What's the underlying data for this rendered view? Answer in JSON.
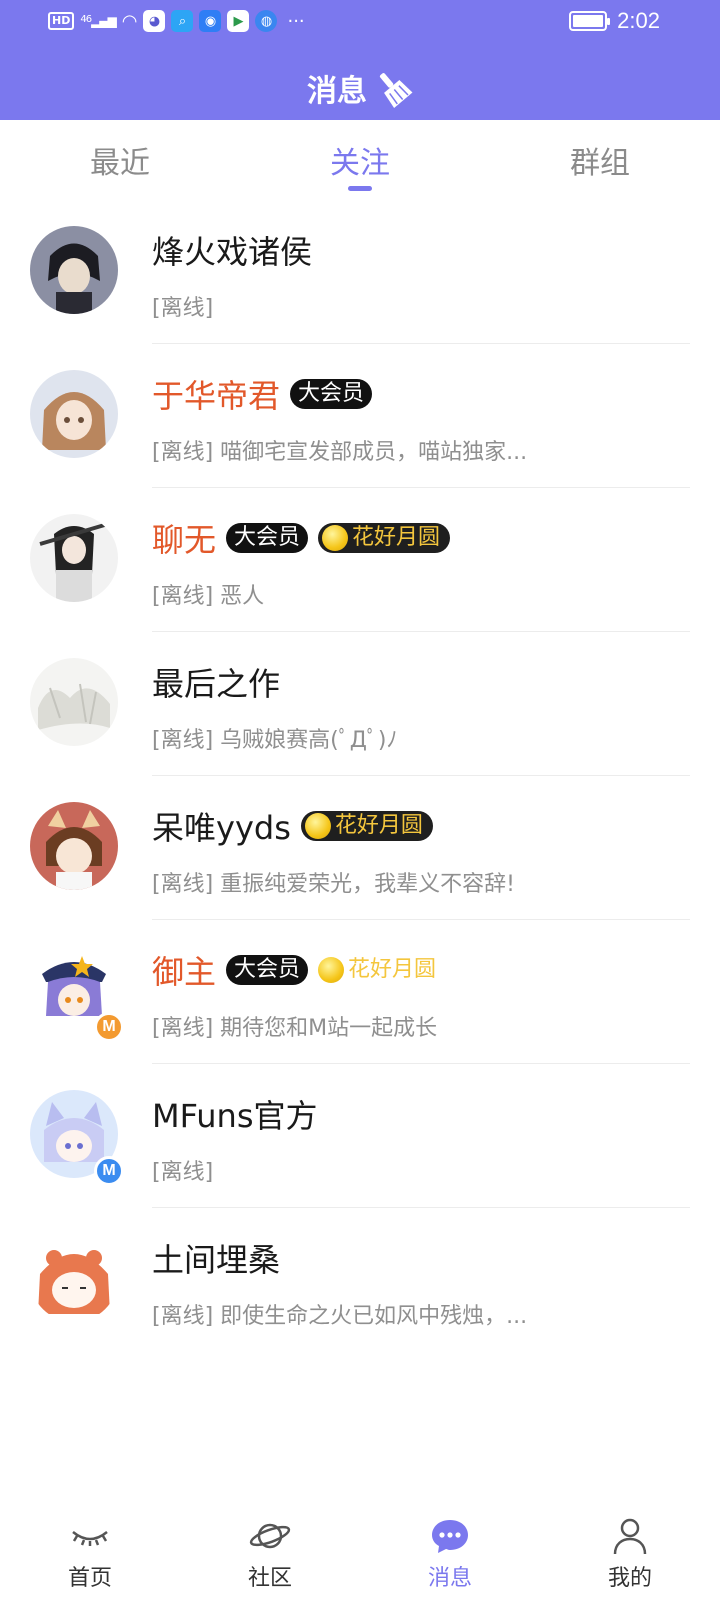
{
  "status_bar": {
    "network": "HD",
    "signal": "46",
    "time": "2:02",
    "more": "···"
  },
  "header": {
    "title": "消息",
    "icon": "broom-icon"
  },
  "tabs": [
    {
      "label": "最近",
      "active": false
    },
    {
      "label": "关注",
      "active": true
    },
    {
      "label": "群组",
      "active": false
    }
  ],
  "contacts": [
    {
      "name": "烽火戏诸侯",
      "vip": false,
      "vip_label": "",
      "moon_label": "",
      "preview": "[离线]"
    },
    {
      "name": "于华帝君",
      "vip": true,
      "vip_label": "大会员",
      "moon_label": "",
      "preview": "[离线] 喵御宅宣发部成员，喵站独家..."
    },
    {
      "name": "聊无",
      "vip": true,
      "vip_label": "大会员",
      "moon_label": "花好月圆",
      "preview": "[离线] 恶人"
    },
    {
      "name": "最后之作",
      "vip": false,
      "vip_label": "",
      "moon_label": "",
      "preview": "[离线] 乌贼娘赛高(ﾟДﾟ)ﾉ"
    },
    {
      "name": "呆唯yyds",
      "vip": false,
      "vip_label": "",
      "moon_label": "花好月圆",
      "preview": "[离线] 重振纯爱荣光，我辈义不容辞!"
    },
    {
      "name": "御主",
      "vip": true,
      "vip_label": "大会员",
      "moon_label": "花好月圆",
      "preview": "[离线] 期待您和M站一起成长"
    },
    {
      "name": "MFuns官方",
      "vip": false,
      "vip_label": "",
      "moon_label": "",
      "preview": "[离线]"
    },
    {
      "name": "土间埋桑",
      "vip": false,
      "vip_label": "",
      "moon_label": "",
      "preview": "[离线] 即使生命之火已如风中残烛，..."
    }
  ],
  "badge_m": "M",
  "bottom_nav": [
    {
      "label": "首页",
      "icon": "eye-closed-icon",
      "active": false
    },
    {
      "label": "社区",
      "icon": "planet-icon",
      "active": false
    },
    {
      "label": "消息",
      "icon": "chat-bubble-icon",
      "active": true
    },
    {
      "label": "我的",
      "icon": "person-icon",
      "active": false
    }
  ],
  "colors": {
    "accent": "#7b78ee",
    "vip_name": "#e2582a",
    "moon": "#f4c63d",
    "muted": "#8f8f8f"
  }
}
